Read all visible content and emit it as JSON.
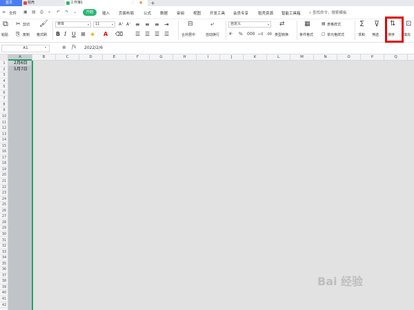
{
  "tabs": {
    "home": "首页",
    "docer": "稻壳",
    "workbook": "工作簿1"
  },
  "menu": {
    "file": "文件",
    "start": "开始",
    "insert": "插入",
    "page_layout": "页面布局",
    "formulas": "公式",
    "data": "数据",
    "review": "审阅",
    "view": "视图",
    "developer": "开发工具",
    "member": "会员专享",
    "resources": "稻壳资源",
    "smart_toolbox": "智能工具箱",
    "search": "查找命令、搜索模板"
  },
  "ribbon": {
    "paste": "粘贴",
    "cut": "剪切",
    "copy": "复制",
    "format_painter": "格式刷",
    "font_name": "宋体",
    "font_size": "11",
    "merge_center": "合并居中",
    "wrap_text": "自动换行",
    "number_format": "自定义",
    "type_convert": "类型转换",
    "conditional_format": "条件格式",
    "table_style": "表格样式",
    "cell_style": "单元格样式",
    "sum": "求和",
    "filter": "筛选",
    "sort": "排序",
    "fill": "填充"
  },
  "formula_bar": {
    "cell_ref": "A1",
    "fx": "fx",
    "value": "2022/2/6"
  },
  "columns": [
    "A",
    "B",
    "C",
    "D",
    "E",
    "F",
    "G",
    "H",
    "I",
    "J",
    "K",
    "L",
    "M",
    "N",
    "O",
    "P",
    "Q"
  ],
  "rows": [
    "1",
    "2",
    "3",
    "4",
    "5",
    "6",
    "7",
    "8",
    "9",
    "10",
    "11",
    "12",
    "13",
    "14",
    "15",
    "16",
    "17",
    "18",
    "19",
    "20",
    "21",
    "22",
    "23",
    "24",
    "25",
    "26",
    "27",
    "28",
    "29",
    "30",
    "31",
    "32",
    "33",
    "34",
    "35",
    "36",
    "37",
    "38",
    "39",
    "40",
    "41",
    "42"
  ],
  "cells": {
    "A1": "2月6日",
    "A2": "5月7日"
  },
  "colors": {
    "accent_green": "#1fa463",
    "tab_blue": "#4a7df5",
    "highlight_red": "#e60000"
  },
  "watermark": "Bai 经验"
}
